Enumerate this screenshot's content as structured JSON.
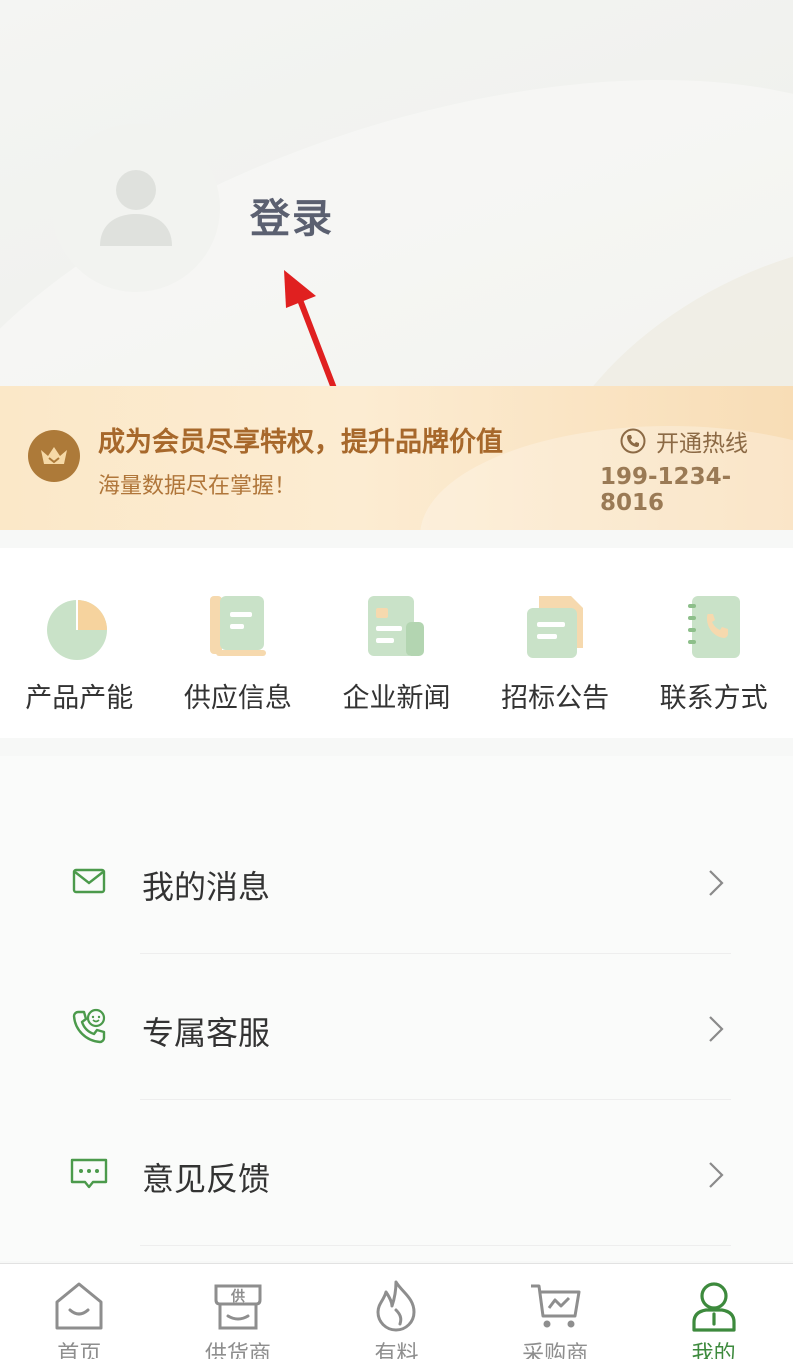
{
  "header": {
    "login_label": "登录"
  },
  "banner": {
    "title": "成为会员尽享特权，提升品牌价值",
    "subtitle": "海量数据尽在掌握！",
    "hotline_label": "开通热线",
    "hotline_number": "199-1234-8016"
  },
  "quick_links": [
    {
      "label": "产品产能",
      "icon": "pie-chart-icon"
    },
    {
      "label": "供应信息",
      "icon": "document-icon"
    },
    {
      "label": "企业新闻",
      "icon": "news-icon"
    },
    {
      "label": "招标公告",
      "icon": "announcement-icon"
    },
    {
      "label": "联系方式",
      "icon": "contact-book-icon"
    }
  ],
  "menu": [
    {
      "label": "我的消息",
      "icon": "mail-icon"
    },
    {
      "label": "专属客服",
      "icon": "customer-service-icon"
    },
    {
      "label": "意见反馈",
      "icon": "feedback-icon"
    }
  ],
  "tabs": [
    {
      "label": "首页",
      "icon": "home-icon",
      "active": false
    },
    {
      "label": "供货商",
      "icon": "supplier-icon",
      "active": false
    },
    {
      "label": "有料",
      "icon": "flame-icon",
      "active": false
    },
    {
      "label": "采购商",
      "icon": "cart-icon",
      "active": false
    },
    {
      "label": "我的",
      "icon": "user-icon",
      "active": true
    }
  ],
  "colors": {
    "accent_green": "#3d8a3d",
    "banner_gold": "#a7682b",
    "annotation_arrow": "#e02020"
  }
}
